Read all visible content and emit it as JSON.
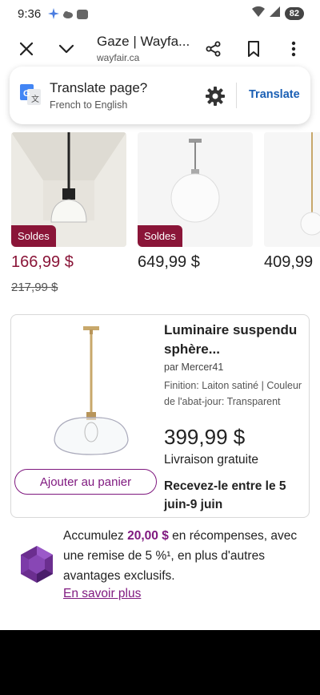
{
  "status_bar": {
    "time": "9:36",
    "battery": "82"
  },
  "browser": {
    "title": "Gaze | Wayfa...",
    "domain": "wayfair.ca"
  },
  "translate": {
    "title": "Translate page?",
    "subtitle": "French to English",
    "action": "Translate"
  },
  "carousel": {
    "items": [
      {
        "badge": "Soldes",
        "price": "166,99 $",
        "old_price": "217,99 $",
        "on_sale": true
      },
      {
        "badge": "Soldes",
        "price": "649,99 $",
        "old_price": "",
        "on_sale": false
      },
      {
        "badge": "",
        "price": "409,99",
        "old_price": "",
        "on_sale": false
      }
    ]
  },
  "featured": {
    "title": "Luminaire suspendu sphère...",
    "brand": "par Mercer41",
    "spec": "Finition: Laiton satiné | Couleur de l'abat-jour: Transparent",
    "price": "399,99 $",
    "shipping": "Livraison gratuite",
    "add_to_cart": "Ajouter au panier",
    "delivery": "Recevez-le entre le 5 juin-9 juin"
  },
  "rewards": {
    "text_before": "Accumulez ",
    "amount": "20,00 $",
    "text_after": " en récompenses, avec une remise de 5 %¹, en plus d'autres avantages exclusifs.",
    "link": "En savoir plus"
  },
  "colors": {
    "brand_purple": "#7f187f",
    "sale_red": "#8a1538",
    "link_blue": "#1a5fb4"
  }
}
